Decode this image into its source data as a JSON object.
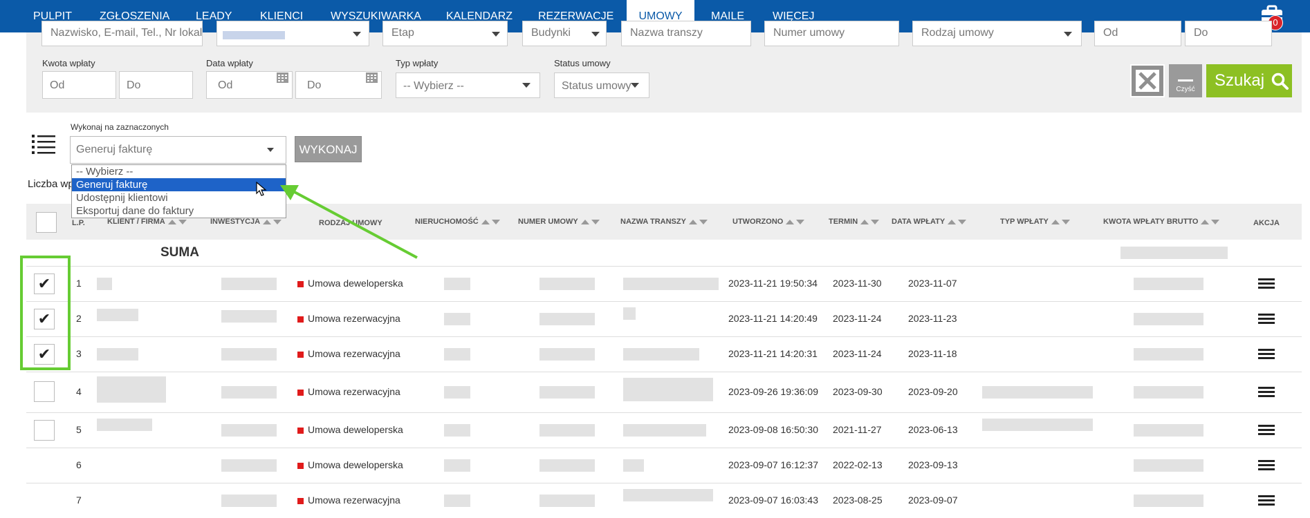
{
  "nav": {
    "items": [
      "PULPIT",
      "ZGŁOSZENIA",
      "LEADY",
      "KLIENCI",
      "WYSZUKIWARKA",
      "KALENDARZ",
      "REZERWACJE",
      "UMOWY",
      "MAILE",
      "WIĘCEJ"
    ],
    "active": "UMOWY",
    "badge": "0"
  },
  "filters": {
    "top_placeholders": [
      "Nazwisko, E-mail, Tel., Nr lokalu",
      "",
      "Etap",
      "Budynki",
      "Nazwa transzy",
      "Numer umowy",
      "Rodzaj umowy",
      "Od",
      "Do"
    ],
    "kwota_label": "Kwota wpłaty",
    "kwota_od": "Od",
    "kwota_do": "Do",
    "data_label": "Data wpłaty",
    "data_od": "Od",
    "data_do": "Do",
    "typ_label": "Typ wpłaty",
    "typ_value": "-- Wybierz --",
    "status_label": "Status umowy",
    "status_value": "Status umowy",
    "clear_label": "Czyść",
    "search_label": "Szukaj"
  },
  "bulk": {
    "label": "Wykonaj na zaznaczonych",
    "selected": "Generuj fakturę",
    "execute_label": "WYKONAJ",
    "options": [
      "-- Wybierz --",
      "Generuj fakturę",
      "Udostępnij klientowi",
      "Eksportuj dane do faktury"
    ]
  },
  "count_label": "Liczba wp",
  "table": {
    "headers": [
      "L.P.",
      "KLIENT / FIRMA",
      "INWESTYCJA",
      "RODZAJ UMOWY",
      "NIERUCHOMOŚĆ",
      "NUMER UMOWY",
      "NAZWA TRANSZY",
      "UTWORZONO",
      "TERMIN",
      "DATA WPŁATY",
      "TYP WPŁATY",
      "KWOTA WPŁATY BRUTTO",
      "AKCJA"
    ],
    "sum_label": "SUMA",
    "rows": [
      {
        "lp": "1",
        "rodzaj": "Umowa deweloperska",
        "utworzono": "2023-11-21 19:50:34",
        "termin": "2023-11-30",
        "data_wplaty": "2023-11-07",
        "checked": "✔"
      },
      {
        "lp": "2",
        "rodzaj": "Umowa rezerwacyjna",
        "utworzono": "2023-11-21 14:20:49",
        "termin": "2023-11-24",
        "data_wplaty": "2023-11-23",
        "checked": "✔"
      },
      {
        "lp": "3",
        "rodzaj": "Umowa rezerwacyjna",
        "utworzono": "2023-11-21 14:20:31",
        "termin": "2023-11-24",
        "data_wplaty": "2023-11-18",
        "checked": "✔"
      },
      {
        "lp": "4",
        "rodzaj": "Umowa rezerwacyjna",
        "utworzono": "2023-09-26 19:36:09",
        "termin": "2023-09-30",
        "data_wplaty": "2023-09-20",
        "checked": ""
      },
      {
        "lp": "5",
        "rodzaj": "Umowa deweloperska",
        "utworzono": "2023-09-08 16:50:30",
        "termin": "2021-11-27",
        "data_wplaty": "2023-06-13",
        "checked": ""
      },
      {
        "lp": "6",
        "rodzaj": "Umowa deweloperska",
        "utworzono": "2023-09-07 16:12:37",
        "termin": "2022-02-13",
        "data_wplaty": "2023-09-13",
        "checked": ""
      },
      {
        "lp": "7",
        "rodzaj": "Umowa rezerwacyjna",
        "utworzono": "2023-09-07 16:03:43",
        "termin": "2023-08-25",
        "data_wplaty": "2023-09-07",
        "checked": ""
      }
    ]
  },
  "colors": {
    "nav_bg": "#0b5aa8",
    "accent_green": "#8dc023",
    "highlight_green": "#66cc33",
    "status_red": "#e01b1b",
    "selected_option": "#1e63c8"
  }
}
